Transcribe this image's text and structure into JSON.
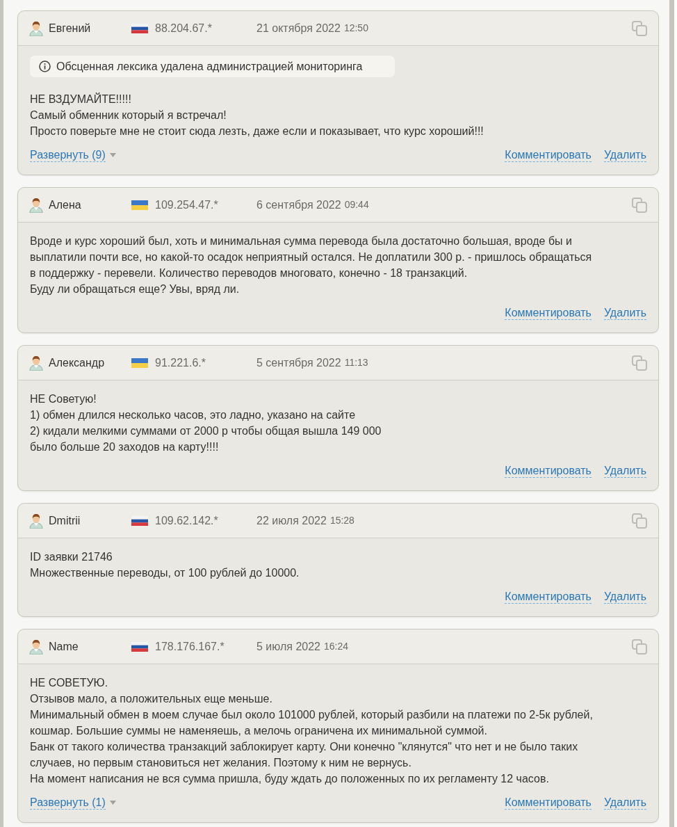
{
  "reviews": [
    {
      "author": "Евгений",
      "flag": {
        "kind": "russia"
      },
      "ip": "88.204.67.*",
      "date": "21 октября 2022",
      "time": "12:50",
      "notice": "Обсценная лексика удалена администрацией мониторинга",
      "text": "НЕ ВЗДУМАЙТЕ!!!!!\nСамый обменник который я встречал!\nПросто поверьте мне не стоит сюда лезть, даже если и показывает, что курс хороший!!!",
      "expand": "Развернуть (9)",
      "actions": [
        "Комментировать",
        "Удалить"
      ]
    },
    {
      "author": "Алена",
      "flag": {
        "kind": "ukraine"
      },
      "ip": "109.254.47.*",
      "date": "6 сентября 2022",
      "time": "09:44",
      "text": "Вроде и курс хороший был, хоть и минимальная сумма перевода была достаточно большая, вроде бы и\nвыплатили почти все, но какой-то осадок неприятный остался. Не доплатили 300 р. - пришлось обращаться\nв поддержку - перевели. Количество переводов многовато, конечно - 18 транзакций.\nБуду ли обращаться еще? Увы, вряд ли.",
      "actions": [
        "Комментировать",
        "Удалить"
      ]
    },
    {
      "author": "Александр",
      "flag": {
        "kind": "ukraine"
      },
      "ip": "91.221.6.*",
      "date": "5 сентября 2022",
      "time": "11:13",
      "text": "НЕ Советую!\n1) обмен длился несколько часов, это ладно, указано на сайте\n2) кидали мелкими суммами от 2000 р чтобы общая вышла 149 000\nбыло больше 20 заходов на карту!!!!",
      "actions": [
        "Комментировать",
        "Удалить"
      ]
    },
    {
      "author": "Dmitrii",
      "flag": {
        "kind": "russia"
      },
      "ip": "109.62.142.*",
      "date": "22 июля 2022",
      "time": "15:28",
      "text": "ID заявки 21746\nМножественные переводы, от 100 рублей до 10000.",
      "actions": [
        "Комментировать",
        "Удалить"
      ]
    },
    {
      "author": "Name",
      "flag": {
        "kind": "russia"
      },
      "ip": "178.176.167.*",
      "date": "5 июля 2022",
      "time": "16:24",
      "text": "НЕ СОВЕТУЮ.\nОтзывов мало, а положительных еще меньше.\nМинимальный обмен в моем случае был около 101000 рублей, который разбили на платежи по 2-5к рублей,\nкошмар. Большие суммы не наменяешь, а мелочь ограничена их минимальной суммой.\nБанк от такого количества транзакций заблокирует карту. Они конечно \"клянутся\" что нет и не было таких\nслучаев, но первым становиться нет желания. Поэтому к ним не вернусь.\nНа момент написания не вся сумма пришла, буду ждать до положенных по их регламенту 12 часов.",
      "expand": "Развернуть (1)",
      "actions": [
        "Комментировать",
        "Удалить"
      ]
    }
  ]
}
